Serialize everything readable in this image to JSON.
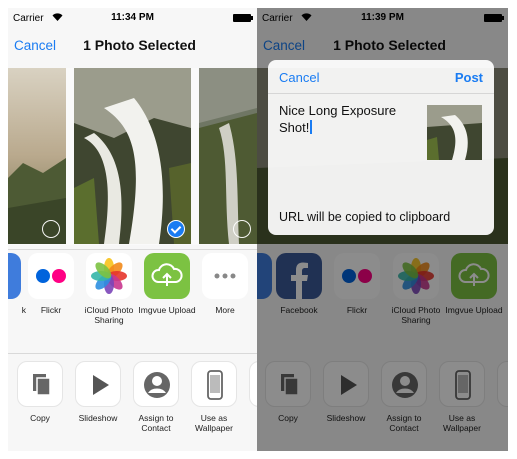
{
  "left": {
    "status": {
      "carrier": "Carrier",
      "time": "11:34 PM"
    },
    "nav": {
      "cancel": "Cancel",
      "title": "1 Photo Selected"
    },
    "share_apps": [
      {
        "label": "k",
        "icon": "messages-icon"
      },
      {
        "label": "Flickr",
        "icon": "flickr-icon"
      },
      {
        "label": "iCloud Photo Sharing",
        "icon": "icloud-photo-sharing-icon"
      },
      {
        "label": "Imgvue Upload",
        "icon": "imgvue-upload-icon"
      },
      {
        "label": "More",
        "icon": "more-icon"
      }
    ],
    "actions": [
      {
        "label": "Copy",
        "icon": "copy-icon"
      },
      {
        "label": "Slideshow",
        "icon": "play-icon"
      },
      {
        "label": "Assign to Contact",
        "icon": "contact-icon"
      },
      {
        "label": "Use as Wallpaper",
        "icon": "phone-icon"
      }
    ]
  },
  "right": {
    "status": {
      "carrier": "Carrier",
      "time": "11:39 PM"
    },
    "nav": {
      "cancel": "Cancel",
      "title": "1 Photo Selected"
    },
    "compose": {
      "cancel": "Cancel",
      "post": "Post",
      "text": "Nice Long Exposure Shot!",
      "footer": "URL will be copied to clipboard"
    },
    "share_apps": [
      {
        "label": "Facebook",
        "icon": "facebook-icon"
      },
      {
        "label": "Flickr",
        "icon": "flickr-icon"
      },
      {
        "label": "iCloud Photo Sharing",
        "icon": "icloud-photo-sharing-icon"
      },
      {
        "label": "Imgvue Upload",
        "icon": "imgvue-upload-icon"
      }
    ],
    "actions": [
      {
        "label": "Copy",
        "icon": "copy-icon"
      },
      {
        "label": "Slideshow",
        "icon": "play-icon"
      },
      {
        "label": "Assign to Contact",
        "icon": "contact-icon"
      },
      {
        "label": "Use as Wallpaper",
        "icon": "phone-icon"
      }
    ]
  },
  "colors": {
    "accent": "#1a7cf2",
    "imgvue": "#7cc242",
    "facebook": "#3b5998",
    "flickr_blue": "#0063dc",
    "flickr_pink": "#ff0084"
  }
}
